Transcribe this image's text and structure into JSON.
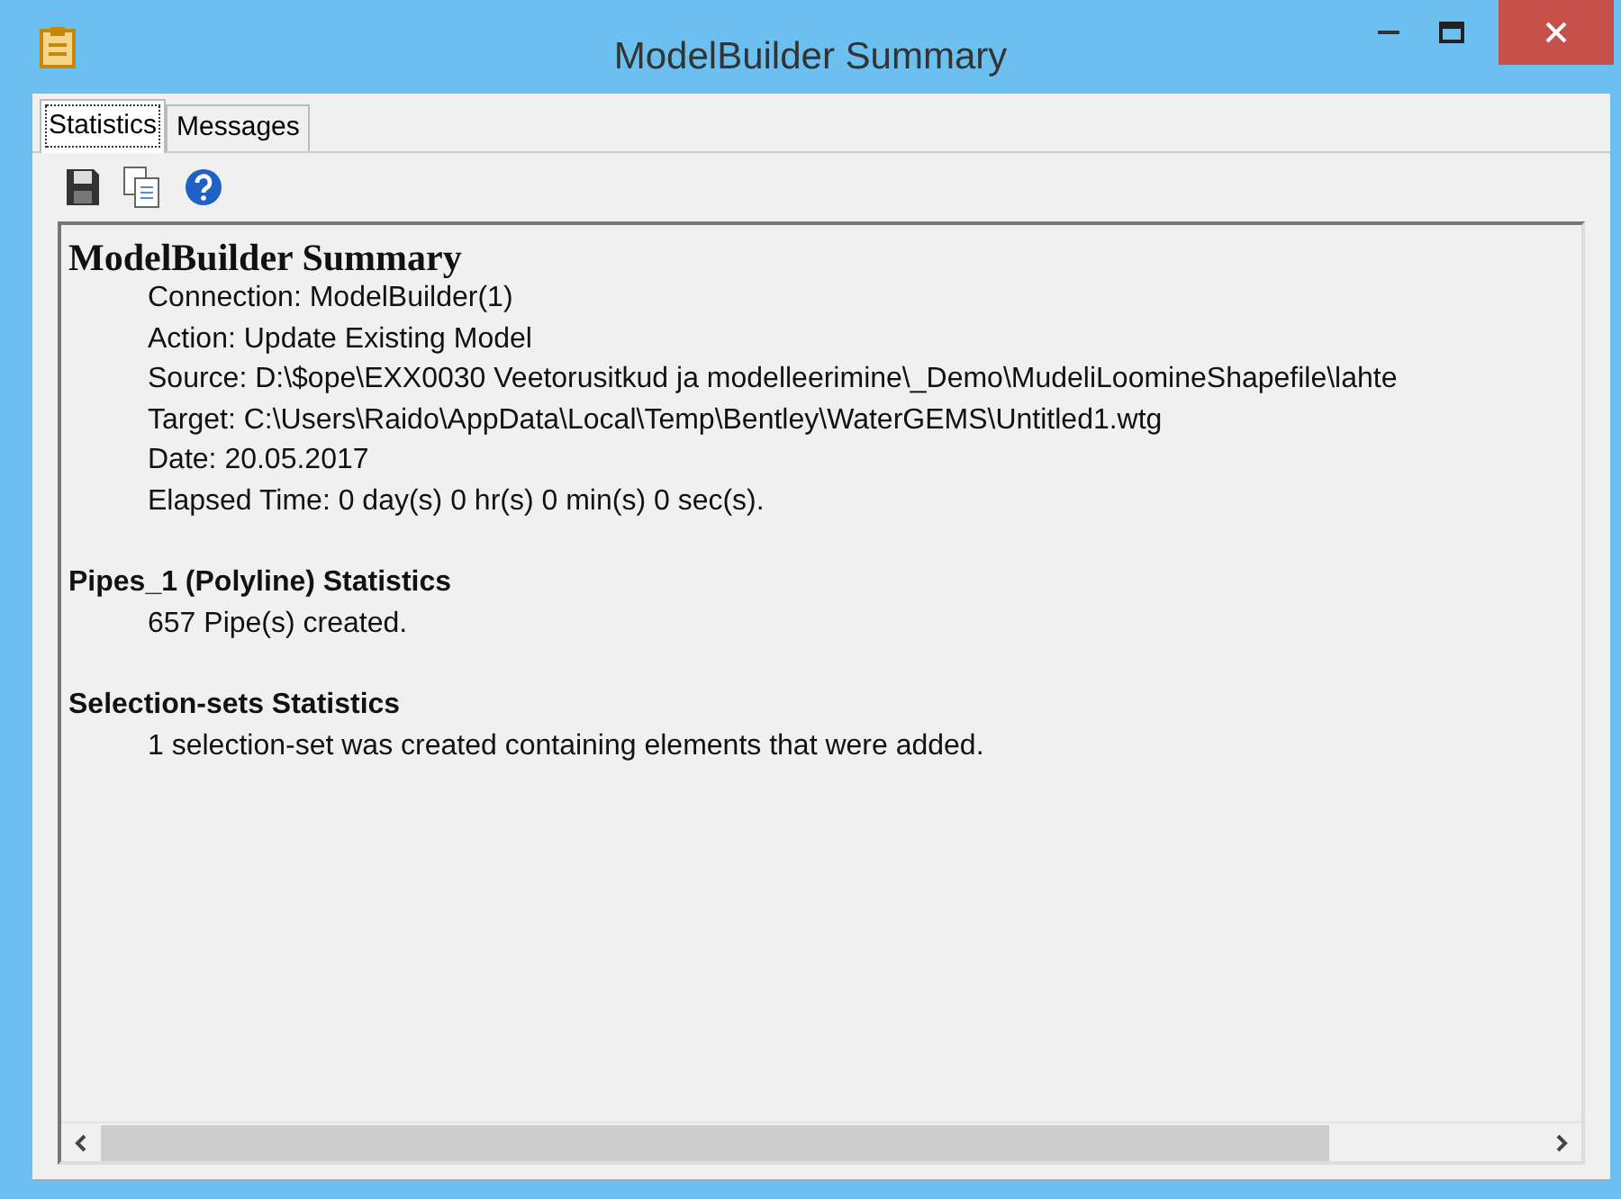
{
  "window": {
    "title": "ModelBuilder Summary"
  },
  "tabs": [
    {
      "label": "Statistics",
      "selected": true
    },
    {
      "label": "Messages",
      "selected": false
    }
  ],
  "report": {
    "heading": "ModelBuilder Summary",
    "details": [
      "Connection: ModelBuilder(1)",
      "Action: Update Existing Model",
      "Source: D:\\$ope\\EXX0030 Veetorusitkud ja modelleerimine\\_Demo\\MudeliLoomineShapefile\\lahte",
      "Target: C:\\Users\\Raido\\AppData\\Local\\Temp\\Bentley\\WaterGEMS\\Untitled1.wtg",
      "Date: 20.05.2017",
      "Elapsed Time: 0 day(s) 0 hr(s) 0 min(s) 0 sec(s)."
    ],
    "sections": [
      {
        "title": "Pipes_1 (Polyline) Statistics",
        "lines": [
          "657 Pipe(s) created."
        ]
      },
      {
        "title": "Selection-sets Statistics",
        "lines": [
          "1 selection-set was created containing elements that were added."
        ]
      }
    ]
  }
}
